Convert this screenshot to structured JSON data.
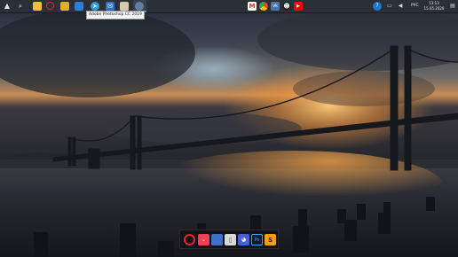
{
  "taskbar": {
    "tooltip_text": "Adobe Photoshop CC 2019",
    "language": "РУС",
    "clock_time": "13:13",
    "clock_date": "15.05.2020",
    "left_icons": [
      "start-icon",
      "search-icon",
      "file-explorer-icon",
      "opera-icon",
      "folder-icon",
      "windows-store-icon",
      "telegram-icon",
      "mail-icon",
      "photoshop-icon",
      "app-icon",
      "steam-icon"
    ],
    "center_icons": [
      "gmail-icon",
      "chrome-icon",
      "vk-icon",
      "steam-chat-icon",
      "youtube-icon"
    ],
    "tray_icons": [
      "teamviewer-icon",
      "network-icon",
      "volume-icon",
      "notifications-icon"
    ]
  },
  "dock": {
    "apps": [
      "opera-gx-icon",
      "pocket-icon",
      "save-file-icon",
      "trash-bin-icon",
      "discord-icon",
      "photoshop-icon",
      "sublime-text-icon"
    ]
  },
  "colors": {
    "taskbar_bg": "#2b2f36",
    "accent": "#3b8ee0",
    "sunset": "#f5a13c"
  }
}
